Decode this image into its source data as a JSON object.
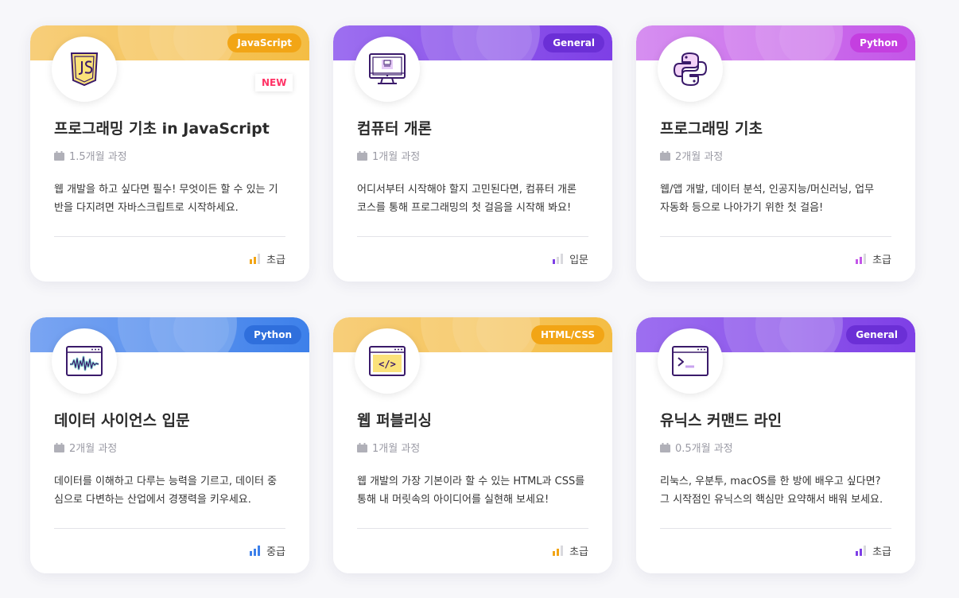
{
  "cards": [
    {
      "category": "JavaScript",
      "badge_color": "#f2a516",
      "banner_from": "#f7ce7a",
      "banner_to": "#f4bd44",
      "icon": "javascript-icon",
      "new_label": "NEW",
      "title": "프로그래밍 기초 in JavaScript",
      "duration": "1.5개월 과정",
      "description": "웹 개발을 하고 싶다면 필수! 무엇이든 할 수 있는 기\n반을 다지려면 자바스크립트로 시작하세요.",
      "level": "초급",
      "level_filled": 2,
      "level_color": "#f2a516"
    },
    {
      "category": "General",
      "badge_color": "#6b2fd6",
      "banner_from": "#9d6ff0",
      "banner_to": "#7e3fe6",
      "icon": "computer-monitor-icon",
      "title": "컴퓨터 개론",
      "duration": "1개월 과정",
      "description": "어디서부터 시작해야 할지 고민된다면, 컴퓨터 개론\n코스를 통해 프로그래밍의 첫 걸음을 시작해 봐요!",
      "level": "입문",
      "level_filled": 1,
      "level_color": "#7e3fe6"
    },
    {
      "category": "Python",
      "badge_color": "#c43fe0",
      "banner_from": "#d68ff0",
      "banner_to": "#c356e8",
      "icon": "python-icon",
      "title": "프로그래밍 기초",
      "duration": "2개월 과정",
      "description": "웹/앱 개발, 데이터 분석, 인공지능/머신러닝, 업무\n자동화 등으로 나아가기 위한 첫 걸음!",
      "level": "초급",
      "level_filled": 2,
      "level_color": "#c356e8"
    },
    {
      "category": "Python",
      "badge_color": "#2f6fdc",
      "banner_from": "#7aa5f2",
      "banner_to": "#3d80ea",
      "icon": "waveform-window-icon",
      "title": "데이터 사이언스 입문",
      "duration": "2개월 과정",
      "description": "데이터를 이해하고 다루는 능력을 기르고, 데이터 중\n심으로 다변하는 산업에서 경쟁력을 키우세요.",
      "level": "중급",
      "level_filled": 3,
      "level_color": "#3d80ea"
    },
    {
      "category": "HTML/CSS",
      "badge_color": "#f2a516",
      "banner_from": "#f7ce7a",
      "banner_to": "#f4bd44",
      "icon": "code-window-icon",
      "title": "웹 퍼블리싱",
      "duration": "1개월 과정",
      "description": "웹 개발의 가장 기본이라 할 수 있는 HTML과 CSS를\n통해 내 머릿속의 아이디어를 실현해 보세요!",
      "level": "초급",
      "level_filled": 2,
      "level_color": "#f2a516"
    },
    {
      "category": "General",
      "badge_color": "#6b2fd6",
      "banner_from": "#9d6ff0",
      "banner_to": "#7e3fe6",
      "icon": "terminal-window-icon",
      "title": "유닉스 커맨드 라인",
      "duration": "0.5개월 과정",
      "description": "리눅스, 우분투, macOS를 한 방에 배우고 싶다면?\n그 시작점인 유닉스의 핵심만 요약해서 배워 보세요.",
      "level": "초급",
      "level_filled": 2,
      "level_color": "#7e3fe6"
    }
  ]
}
